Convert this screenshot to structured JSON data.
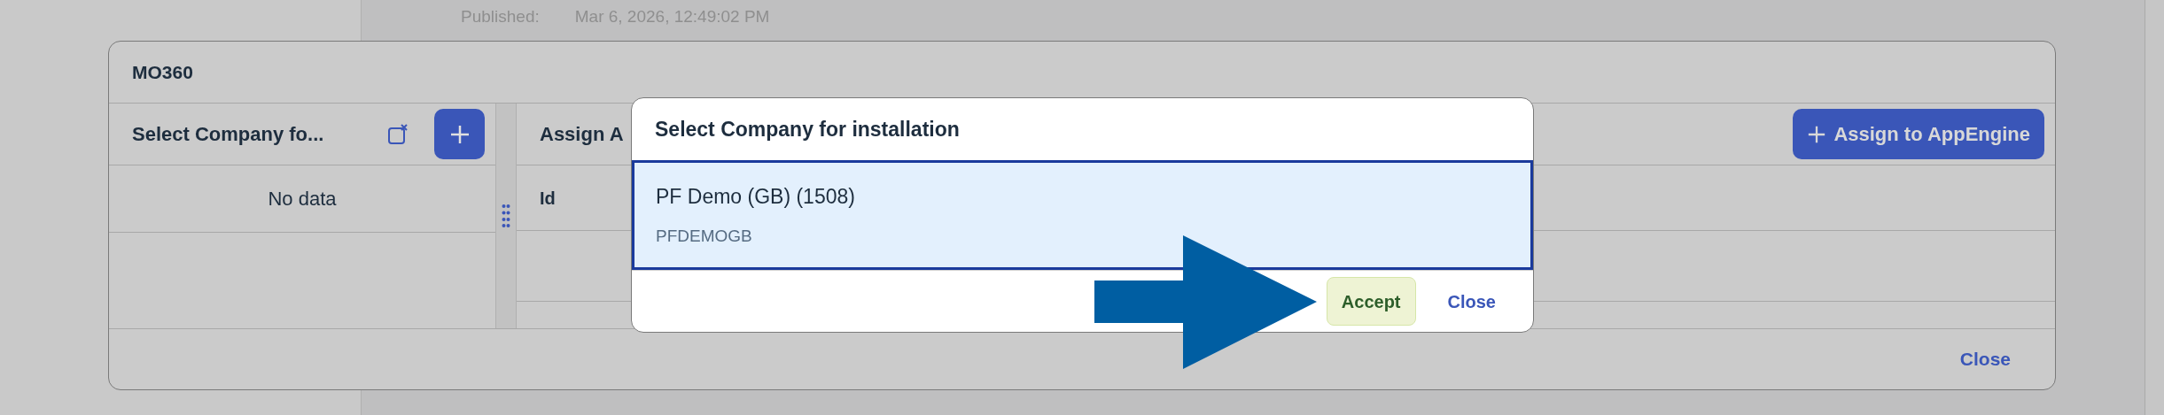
{
  "background": {
    "published_label": "Published:",
    "published_value": "Mar 6, 2026, 12:49:02 PM"
  },
  "dialog": {
    "title": "MO360",
    "left_pane": {
      "title": "Select Company fo...",
      "empty_text": "No data"
    },
    "right_pane": {
      "title": "Assign A",
      "assign_button": "Assign to AppEngine",
      "columns": [
        "Id"
      ]
    },
    "footer_button": "Close"
  },
  "modal": {
    "title": "Select Company for installation",
    "items": [
      {
        "title": "PF Demo (GB) (1508)",
        "subtitle": "PFDEMOGB",
        "selected": true
      }
    ],
    "buttons": [
      {
        "label": "Accept",
        "kind": "emphasized"
      },
      {
        "label": "Close",
        "kind": "transparent"
      }
    ]
  }
}
